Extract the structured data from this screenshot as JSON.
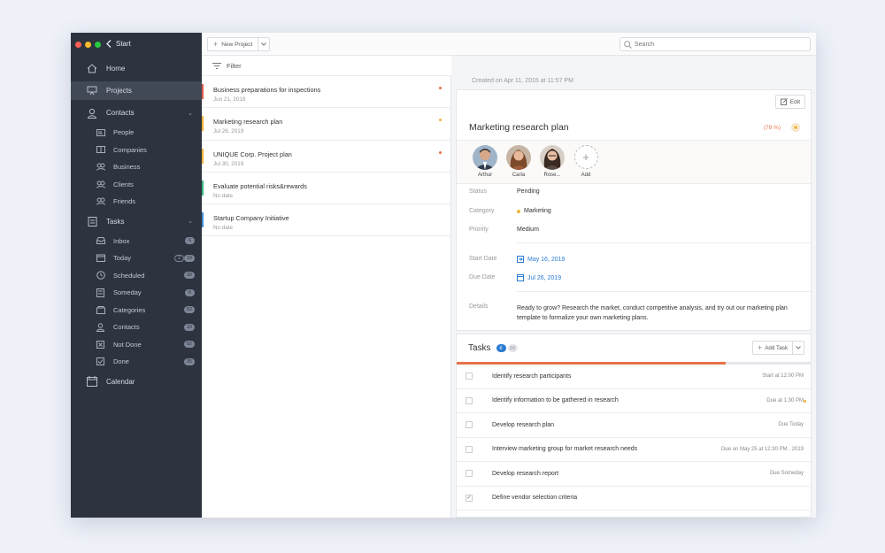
{
  "app": {
    "back_label": "Start",
    "traffic_colors": [
      "#fe5f57",
      "#febc2e",
      "#28c840"
    ]
  },
  "sidebar": {
    "main_items": [
      {
        "label": "Home",
        "icon": "home-icon"
      },
      {
        "label": "Projects",
        "icon": "projects-icon",
        "active": true
      },
      {
        "label": "Contacts",
        "icon": "contacts-icon",
        "expanded": true
      }
    ],
    "contacts_items": [
      {
        "label": "People",
        "icon": "person-card-icon"
      },
      {
        "label": "Companies",
        "icon": "building-icon"
      },
      {
        "label": "Business",
        "icon": "handshake-icon"
      },
      {
        "label": "Clients",
        "icon": "clients-icon"
      },
      {
        "label": "Friends",
        "icon": "friends-icon"
      }
    ],
    "tasks_item": {
      "label": "Tasks",
      "icon": "tasks-icon"
    },
    "tasks_items": [
      {
        "label": "Inbox",
        "icon": "inbox-icon",
        "badge": "6"
      },
      {
        "label": "Today",
        "icon": "today-icon",
        "badge": "19",
        "badge_outline": "2"
      },
      {
        "label": "Scheduled",
        "icon": "clock-icon",
        "badge": "30"
      },
      {
        "label": "Someday",
        "icon": "someday-icon",
        "badge": "6"
      },
      {
        "label": "Categories",
        "icon": "categories-icon",
        "badge": "52"
      },
      {
        "label": "Contacts",
        "icon": "contact-icon",
        "badge": "10"
      },
      {
        "label": "Not Done",
        "icon": "not-done-icon",
        "badge": "52"
      },
      {
        "label": "Done",
        "icon": "done-icon",
        "badge": "35"
      }
    ],
    "calendar_item": {
      "label": "Calendar",
      "icon": "calendar-icon"
    }
  },
  "toolbar": {
    "new_project_label": "New Project",
    "search_placeholder": "Search",
    "filter_label": "Filter"
  },
  "projects": [
    {
      "title": "Business preparations for inspections",
      "date": "Jun 21, 2019",
      "bar_color": "#e05a4a",
      "dot_color": "#e8714a"
    },
    {
      "title": "Marketing research plan",
      "date": "Jul 26, 2019",
      "bar_color": "#f0b33a",
      "dot_color": "#f0b33a"
    },
    {
      "title": "UNIQUE Corp. Project plan",
      "date": "Jul 30, 2019",
      "bar_color": "#f0b33a",
      "dot_color": "#e8714a"
    },
    {
      "title": "Evaluate potential risks&rewards",
      "date": "No date",
      "bar_color": "#3bb57a",
      "dot_color": ""
    },
    {
      "title": "Startup Company Initiative",
      "date": "No date",
      "bar_color": "#3f8ed8",
      "dot_color": ""
    }
  ],
  "detail": {
    "created": "Created on  Apr 11, 2015 at 11:57 PM",
    "edit_label": "Edit",
    "title": "Marketing research plan",
    "percent": "(78 %)",
    "members": [
      "Arthur",
      "Carla",
      "Rose..."
    ],
    "add_member_label": "Add",
    "fields": {
      "status_label": "Status",
      "status_value": "Pending",
      "category_label": "Category",
      "category_value": "Marketing",
      "category_color": "#f0b33a",
      "priority_label": "Priority",
      "priority_value": "Medium",
      "start_label": "Start Date",
      "start_value": "May 16, 2019",
      "due_label": "Due Date",
      "due_value": "Jul 26, 2019",
      "details_label": "Details",
      "details_value": "Ready to grow? Research the market, conduct competitive analysis, and try out our marketing plan template to formalize your own marketing plans."
    }
  },
  "tasks": {
    "title": "Tasks",
    "open_count": "6",
    "total_count": "16",
    "add_label": "Add Task",
    "progress_fraction": 0.76,
    "items": [
      {
        "title": "Identify research participants",
        "due": "Start at 12:00 PM",
        "done": false,
        "flag": false
      },
      {
        "title": "Identify information to be gathered in research",
        "due": "Due at 1:30 PM",
        "done": false,
        "flag": true
      },
      {
        "title": "Develop research plan",
        "due": "Due Today",
        "done": false,
        "flag": false
      },
      {
        "title": "Interview marketing group for market research needs",
        "due": "Due on May 25 at 12:30 PM , 2019",
        "done": false,
        "flag": false
      },
      {
        "title": "Develop research report",
        "due": "Due Someday",
        "done": false,
        "flag": false
      },
      {
        "title": "Define vendor selection criteria",
        "due": "",
        "done": true,
        "flag": false
      }
    ]
  }
}
